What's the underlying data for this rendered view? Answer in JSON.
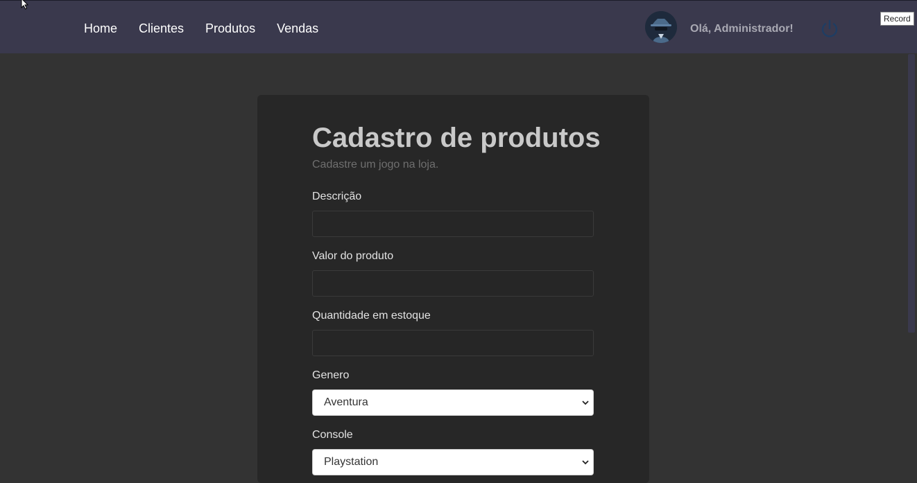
{
  "nav": {
    "items": [
      {
        "label": "Home"
      },
      {
        "label": "Clientes"
      },
      {
        "label": "Produtos"
      },
      {
        "label": "Vendas"
      }
    ]
  },
  "user": {
    "greeting": "Olá, Administrador!"
  },
  "overlay": {
    "record_label": "Record"
  },
  "form": {
    "title": "Cadastro de produtos",
    "subtitle": "Cadastre um jogo na loja.",
    "fields": [
      {
        "label": "Descrição",
        "value": ""
      },
      {
        "label": "Valor do produto",
        "value": ""
      },
      {
        "label": "Quantidade em estoque",
        "value": ""
      }
    ],
    "genero": {
      "label": "Genero",
      "selected": "Aventura"
    },
    "console": {
      "label": "Console",
      "selected": "Playstation"
    }
  },
  "colors": {
    "topbar": "#3a394d",
    "background": "#333333",
    "card": "#272727",
    "power_icon": "#1f3d63"
  }
}
